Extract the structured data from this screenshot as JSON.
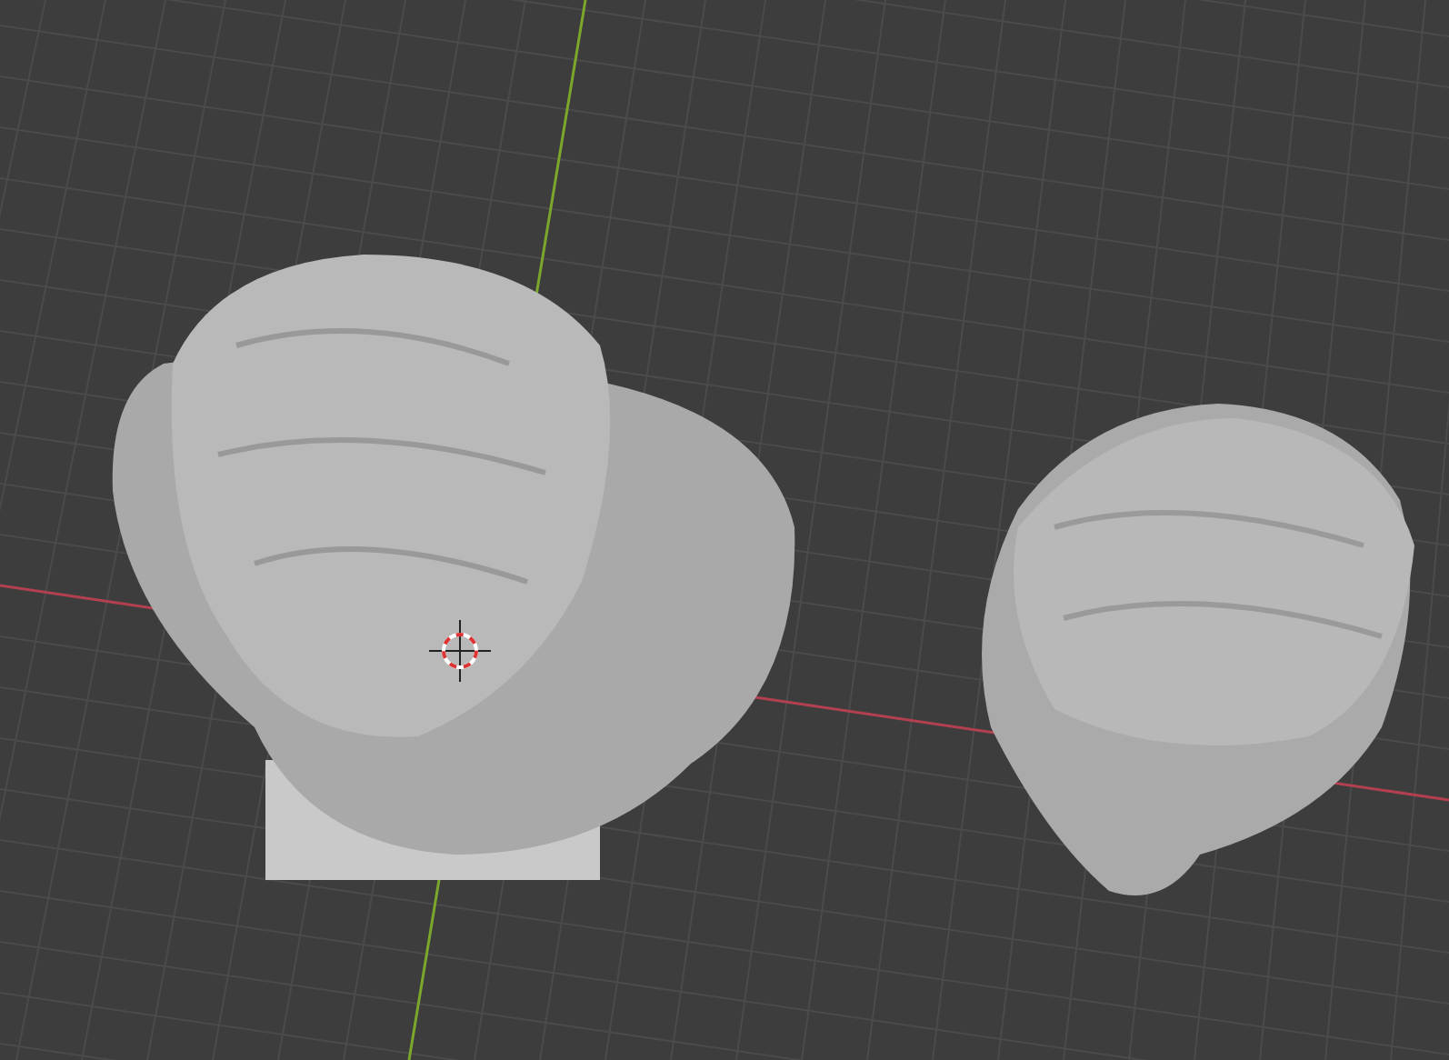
{
  "viewport": {
    "show_grid": true,
    "show_axes": true,
    "show_cursor": true
  },
  "objects": [
    {
      "kind": "bust"
    },
    {
      "kind": "head"
    }
  ]
}
